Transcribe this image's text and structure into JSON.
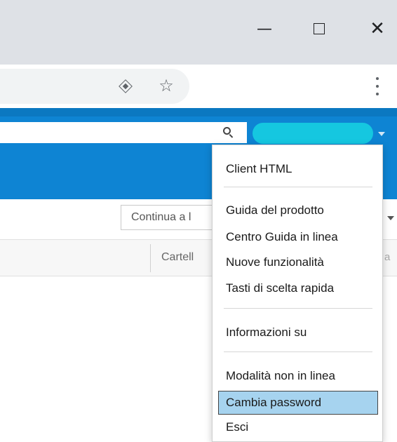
{
  "window": {
    "minimize_glyph": "—",
    "close_glyph": "✕"
  },
  "toolbar": {
    "star_glyph": "☆"
  },
  "appbar": {
    "search_icon": "search-icon",
    "account_menu_icon": "chevron-down-icon"
  },
  "filterbar": {
    "continue_placeholder": "Continua a l"
  },
  "columns": {
    "folder_header": "Cartell",
    "right_header": "a"
  },
  "menu": {
    "items": [
      {
        "label": "Client HTML"
      },
      {
        "label": "Guida del prodotto"
      },
      {
        "label": "Centro Guida in linea"
      },
      {
        "label": "Nuove funzionalità"
      },
      {
        "label": "Tasti di scelta rapida"
      },
      {
        "label": "Informazioni su"
      },
      {
        "label": "Modalità non in linea"
      },
      {
        "label": "Cambia password",
        "selected": true
      },
      {
        "label": "Esci"
      }
    ]
  },
  "colors": {
    "appbar_blue": "#0e84d3",
    "account_pill": "#15c7e0",
    "selection": "#a6d3ef"
  }
}
